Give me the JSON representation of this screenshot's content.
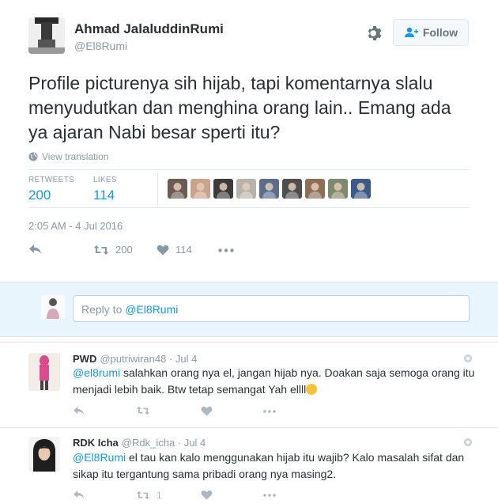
{
  "tweet": {
    "author_name": "Ahmad JalaluddinRumi",
    "author_handle": "@El8Rumi",
    "follow_label": "Follow",
    "text": "Profile picturenya sih hijab, tapi komentarnya slalu menyudutkan dan menghina orang lain.. Emang ada ya ajaran Nabi besar sperti itu?",
    "view_translation": "View translation",
    "retweets_label": "RETWEETS",
    "retweets_count": "200",
    "likes_label": "LIKES",
    "likes_count": "114",
    "timestamp": "2:05 AM - 4 Jul 2016",
    "action_retweet_count": "200",
    "action_like_count": "114",
    "liker_colors": [
      "#6b5b52",
      "#c9a48a",
      "#3b3b3b",
      "#b8b2ad",
      "#5a6e8a",
      "#4e4e4e",
      "#8c6f56",
      "#7e8a6e",
      "#3c5a88"
    ]
  },
  "reply_box": {
    "prefix": "Reply to ",
    "mention": "@El8Rumi"
  },
  "replies": [
    {
      "name": "PWD",
      "handle": "@putriwiran48",
      "time": "· Jul 4",
      "mention": "@el8rumi",
      "text": " salahkan orang nya el,  jangan hijab nya. Doakan saja semoga orang itu menjadi lebih baik. Btw tetap semangat Yah ellll",
      "retweet_count": "",
      "like_count": ""
    },
    {
      "name": "RDK Icha",
      "handle": "@Rdk_icha",
      "time": "· Jul 4",
      "mention": "@El8Rumi",
      "text": " el tau kan kalo menggunakan hijab itu wajib? Kalo masalah sifat dan sikap itu tergantung sama pribadi orang nya masing2.",
      "retweet_count": "1",
      "like_count": ""
    }
  ],
  "colors": {
    "accent": "#1b95e0",
    "muted": "#8899a6",
    "text": "#292f33",
    "reply_bg": "#e8f5fd"
  }
}
